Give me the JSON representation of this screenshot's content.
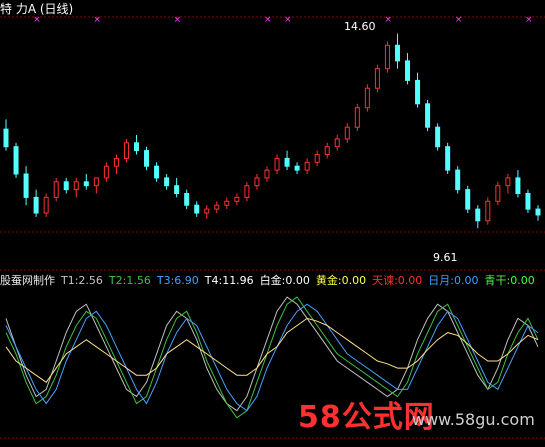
{
  "header": {
    "stock_name": "特  力A",
    "period": "(日线)"
  },
  "price_labels": {
    "high": "14.60",
    "low": "9.61"
  },
  "indicator_legend": [
    {
      "text": "股蚕网制作",
      "color": "#e8e8e8"
    },
    {
      "text": "T1:2.56",
      "color": "#c0c0c0"
    },
    {
      "text": "T2:1.56",
      "color": "#40c040"
    },
    {
      "text": "T3:6.90",
      "color": "#4aa0ff"
    },
    {
      "text": "T4:11.96",
      "color": "#ffffff"
    },
    {
      "text": "白金:0.00",
      "color": "#ffffff"
    },
    {
      "text": "黄金:0.00",
      "color": "#ffff40"
    },
    {
      "text": "天谏:0.00",
      "color": "#ff3030"
    },
    {
      "text": "日月:0.00",
      "color": "#40a0ff"
    },
    {
      "text": "青干:0.00",
      "color": "#40ff40"
    }
  ],
  "watermark": {
    "main_a": "58",
    "main_b": "公式网",
    "url": "www.58gu.com"
  },
  "colors": {
    "up": "#ff3030",
    "down": "#54ffff",
    "grid": "#8b0000",
    "marker": "#ff40ff"
  },
  "chart_data": [
    {
      "type": "candlestick",
      "title": "特力A (日线)",
      "annotations": [
        {
          "label": "14.60",
          "kind": "period-high"
        },
        {
          "label": "9.61",
          "kind": "period-low"
        }
      ],
      "ylim": [
        9.0,
        15.0
      ],
      "candles": [
        [
          12.15,
          12.4,
          11.6,
          11.7
        ],
        [
          11.7,
          11.8,
          10.9,
          11.0
        ],
        [
          11.0,
          11.2,
          10.2,
          10.4
        ],
        [
          10.4,
          10.6,
          9.9,
          10.0
        ],
        [
          10.0,
          10.5,
          9.9,
          10.4
        ],
        [
          10.4,
          10.9,
          10.3,
          10.8
        ],
        [
          10.8,
          10.9,
          10.5,
          10.6
        ],
        [
          10.6,
          10.9,
          10.4,
          10.8
        ],
        [
          10.8,
          11.0,
          10.6,
          10.7
        ],
        [
          10.7,
          10.9,
          10.5,
          10.9
        ],
        [
          10.9,
          11.3,
          10.8,
          11.2
        ],
        [
          11.2,
          11.5,
          11.0,
          11.4
        ],
        [
          11.4,
          11.9,
          11.3,
          11.8
        ],
        [
          11.8,
          12.0,
          11.5,
          11.6
        ],
        [
          11.6,
          11.7,
          11.1,
          11.2
        ],
        [
          11.2,
          11.3,
          10.8,
          10.9
        ],
        [
          10.9,
          11.0,
          10.6,
          10.7
        ],
        [
          10.7,
          10.9,
          10.4,
          10.5
        ],
        [
          10.5,
          10.6,
          10.1,
          10.2
        ],
        [
          10.2,
          10.3,
          9.9,
          10.0
        ],
        [
          10.0,
          10.2,
          9.85,
          10.1
        ],
        [
          10.1,
          10.3,
          10.0,
          10.2
        ],
        [
          10.2,
          10.4,
          10.1,
          10.3
        ],
        [
          10.3,
          10.5,
          10.2,
          10.4
        ],
        [
          10.4,
          10.8,
          10.3,
          10.7
        ],
        [
          10.7,
          11.0,
          10.6,
          10.9
        ],
        [
          10.9,
          11.2,
          10.8,
          11.1
        ],
        [
          11.1,
          11.5,
          11.0,
          11.4
        ],
        [
          11.4,
          11.6,
          11.1,
          11.2
        ],
        [
          11.2,
          11.3,
          11.0,
          11.1
        ],
        [
          11.1,
          11.4,
          11.0,
          11.3
        ],
        [
          11.3,
          11.6,
          11.2,
          11.5
        ],
        [
          11.5,
          11.8,
          11.4,
          11.7
        ],
        [
          11.7,
          12.0,
          11.6,
          11.9
        ],
        [
          11.9,
          12.3,
          11.8,
          12.2
        ],
        [
          12.2,
          12.8,
          12.1,
          12.7
        ],
        [
          12.7,
          13.3,
          12.6,
          13.2
        ],
        [
          13.2,
          13.8,
          13.1,
          13.7
        ],
        [
          13.7,
          14.4,
          13.6,
          14.3
        ],
        [
          14.3,
          14.6,
          13.7,
          13.9
        ],
        [
          13.9,
          14.1,
          13.3,
          13.4
        ],
        [
          13.4,
          13.6,
          12.7,
          12.8
        ],
        [
          12.8,
          12.9,
          12.1,
          12.2
        ],
        [
          12.2,
          12.3,
          11.6,
          11.7
        ],
        [
          11.7,
          11.8,
          11.0,
          11.1
        ],
        [
          11.1,
          11.2,
          10.5,
          10.6
        ],
        [
          10.6,
          10.7,
          10.0,
          10.1
        ],
        [
          10.1,
          10.2,
          9.61,
          9.8
        ],
        [
          9.8,
          10.4,
          9.7,
          10.3
        ],
        [
          10.3,
          10.8,
          10.2,
          10.7
        ],
        [
          10.7,
          11.0,
          10.5,
          10.9
        ],
        [
          10.9,
          11.1,
          10.4,
          10.5
        ],
        [
          10.5,
          10.6,
          10.0,
          10.1
        ],
        [
          10.1,
          10.2,
          9.8,
          9.95
        ]
      ]
    },
    {
      "type": "line",
      "series": [
        {
          "name": "T1",
          "values": [
            80,
            60,
            40,
            25,
            30,
            50,
            70,
            85,
            90,
            75,
            60,
            45,
            30,
            25,
            35,
            55,
            75,
            85,
            80,
            65,
            45,
            30,
            20,
            15,
            25,
            45,
            65,
            85,
            95,
            90,
            80,
            70,
            60,
            50,
            45,
            40,
            35,
            30,
            25,
            30,
            45,
            65,
            80,
            90,
            85,
            70,
            55,
            40,
            30,
            45,
            65,
            80,
            75,
            60
          ]
        },
        {
          "name": "T2",
          "values": [
            70,
            55,
            35,
            20,
            25,
            40,
            60,
            75,
            85,
            80,
            65,
            50,
            35,
            20,
            25,
            45,
            65,
            80,
            85,
            70,
            50,
            35,
            20,
            10,
            15,
            35,
            55,
            75,
            90,
            95,
            85,
            75,
            65,
            55,
            50,
            45,
            40,
            35,
            30,
            25,
            35,
            55,
            70,
            85,
            90,
            75,
            60,
            45,
            30,
            35,
            55,
            70,
            80,
            65
          ]
        },
        {
          "name": "T3",
          "values": [
            75,
            60,
            45,
            30,
            20,
            30,
            50,
            65,
            80,
            85,
            75,
            60,
            45,
            30,
            20,
            35,
            55,
            70,
            80,
            75,
            60,
            45,
            30,
            20,
            15,
            25,
            45,
            60,
            75,
            85,
            90,
            85,
            75,
            65,
            55,
            50,
            45,
            40,
            35,
            30,
            30,
            45,
            60,
            75,
            85,
            80,
            65,
            50,
            35,
            30,
            45,
            60,
            75,
            70
          ]
        },
        {
          "name": "T4",
          "values": [
            60,
            50,
            45,
            40,
            35,
            45,
            55,
            60,
            65,
            60,
            55,
            50,
            45,
            40,
            40,
            45,
            55,
            60,
            65,
            60,
            55,
            50,
            45,
            40,
            40,
            45,
            55,
            60,
            70,
            75,
            80,
            78,
            75,
            70,
            65,
            60,
            55,
            50,
            48,
            45,
            45,
            50,
            58,
            65,
            70,
            68,
            62,
            55,
            50,
            50,
            55,
            62,
            68,
            65
          ]
        }
      ]
    }
  ]
}
